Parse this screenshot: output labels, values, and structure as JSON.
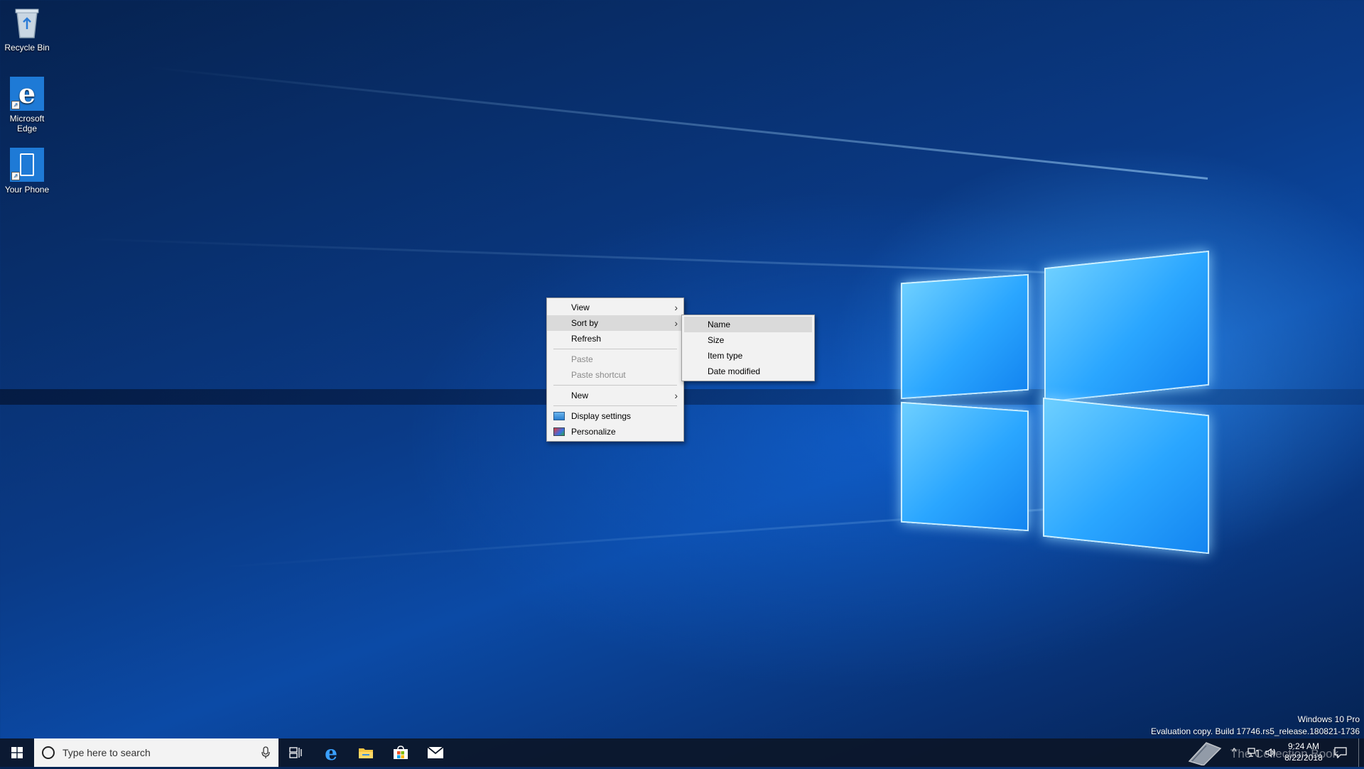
{
  "desktop": {
    "icons": [
      {
        "label": "Recycle Bin",
        "icon": "recycle-bin-icon"
      },
      {
        "label": "Microsoft Edge",
        "icon": "edge-icon"
      },
      {
        "label": "Your Phone",
        "icon": "phone-icon"
      }
    ]
  },
  "context_menu": {
    "view": "View",
    "sort_by": "Sort by",
    "refresh": "Refresh",
    "paste": "Paste",
    "paste_shortcut": "Paste shortcut",
    "new": "New",
    "display_settings": "Display settings",
    "personalize": "Personalize"
  },
  "sort_submenu": {
    "items": [
      "Name",
      "Size",
      "Item type",
      "Date modified"
    ]
  },
  "watermark": {
    "edition": "Windows 10 Pro",
    "build": "Evaluation copy. Build 17746.rs5_release.180821-1736"
  },
  "taskbar": {
    "search_placeholder": "Type here to search",
    "time": "9:24 AM",
    "date": "8/22/2018",
    "overlay_text": "The Collection Book"
  },
  "colors": {
    "accent": "#0078d7",
    "menu_bg": "#f2f2f2",
    "menu_highlight": "#dadada",
    "taskbar_bg": "#0c1628"
  }
}
